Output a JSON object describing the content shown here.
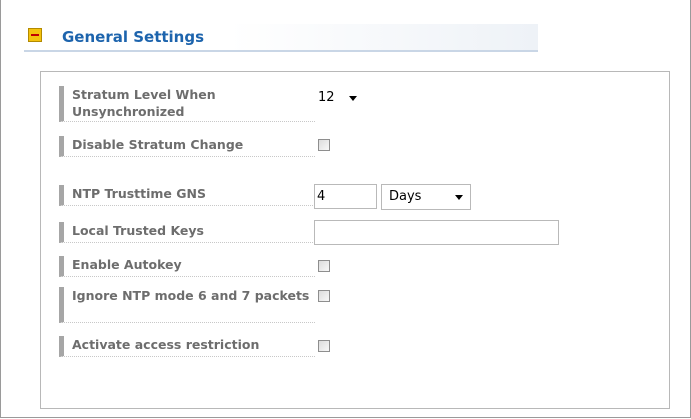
{
  "section": {
    "title": "General Settings",
    "toggle_icon": "collapse-minus-icon"
  },
  "fields": {
    "stratum_level": {
      "label": "Stratum Level When Unsynchronized",
      "value": "12",
      "control": "dropdown"
    },
    "disable_stratum_change": {
      "label": "Disable Stratum Change",
      "checked": false
    },
    "ntp_trusttime": {
      "label": "NTP Trusttime GNS",
      "value": "4",
      "unit": "Days"
    },
    "local_trusted_keys": {
      "label": "Local Trusted Keys",
      "value": ""
    },
    "enable_autokey": {
      "label": "Enable Autokey",
      "checked": false
    },
    "ignore_ntp_mode": {
      "label": "Ignore NTP mode 6 and 7 packets",
      "checked": false
    },
    "activate_access_restriction": {
      "label": "Activate access restriction",
      "checked": false
    }
  },
  "colors": {
    "title": "#1d64ad",
    "label": "#6d6d6d",
    "label_marker": "#a6a6a6"
  }
}
